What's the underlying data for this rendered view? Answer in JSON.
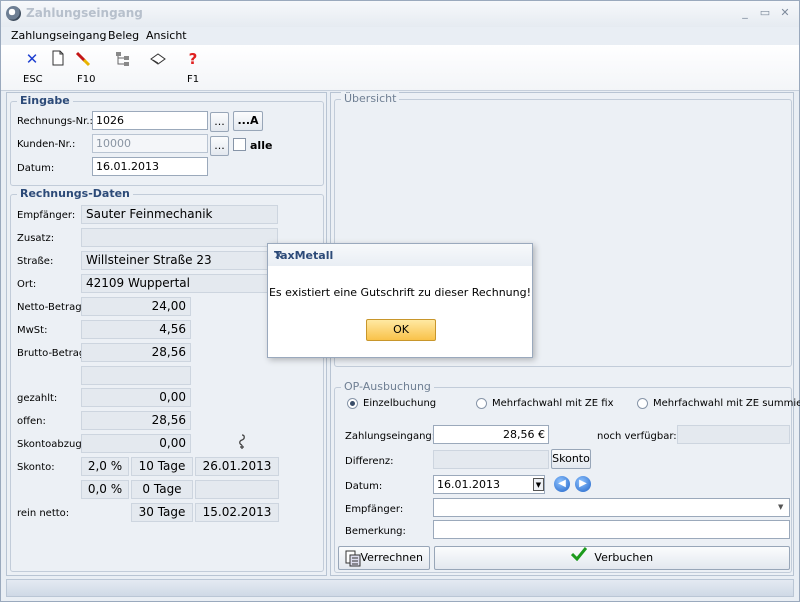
{
  "window": {
    "title": "Zahlungseingang",
    "minimize": "_",
    "maximize": "▭",
    "close": "✕"
  },
  "menu": [
    "Zahlungseingang",
    "Beleg",
    "Ansicht"
  ],
  "toolbar": {
    "esc_label": "ESC",
    "f10_label": "F10",
    "f1_label": "F1",
    "help_glyph": "?"
  },
  "eingabe": {
    "title": "Eingabe",
    "rechnungsnr_label": "Rechnungs-Nr.:",
    "rechnungsnr_value": "1026",
    "kundennr_label": "Kunden-Nr.:",
    "kundennr_value": "10000",
    "datum_label": "Datum:",
    "datum_value": "16.01.2013",
    "dots": "...",
    "a_button": "...A",
    "alle_label": "alle"
  },
  "rechnung": {
    "title": "Rechnungs-Daten",
    "empfaenger_label": "Empfänger:",
    "empfaenger_value": "Sauter Feinmechanik",
    "zusatz_label": "Zusatz:",
    "zusatz_value": "",
    "strasse_label": "Straße:",
    "strasse_value": "Willsteiner Straße 23",
    "ort_label": "Ort:",
    "ort_value": "42109 Wuppertal",
    "netto_label": "Netto-Betrag:",
    "netto_value": "24,00",
    "mwst_label": "MwSt:",
    "mwst_value": "4,56",
    "brutto_label": "Brutto-Betrag:",
    "brutto_value": "28,56",
    "gezahlt_label": "gezahlt:",
    "gezahlt_value": "0,00",
    "offen_label": "offen:",
    "offen_value": "28,56",
    "skontoabzug_label": "Skontoabzug:",
    "skontoabzug_value": "0,00",
    "skonto_label": "Skonto:",
    "skonto1_pct": "2,0 %",
    "skonto1_days": "10 Tage",
    "skonto1_date": "26.01.2013",
    "skonto2_pct": "0,0 %",
    "skonto2_days": "0 Tage",
    "reinnetto_label": "rein netto:",
    "reinnetto_days": "30 Tage",
    "reinnetto_date": "15.02.2013"
  },
  "uebersicht": {
    "title": "Übersicht"
  },
  "op": {
    "title": "OP-Ausbuchung",
    "radio1": "Einzelbuchung",
    "radio2": "Mehrfachwahl mit ZE fix",
    "radio3": "Mehrfachwahl mit ZE summiert",
    "zahlungseingang_label": "Zahlungseingang:",
    "zahlungseingang_value": "28,56 €",
    "noch_label": "noch verfügbar:",
    "differenz_label": "Differenz:",
    "skonto_button": "Skonto",
    "datum_label": "Datum:",
    "datum_value": "16.01.2013",
    "empfaenger_label": "Empfänger:",
    "bemerkung_label": "Bemerkung:",
    "verrechnen_button": "Verrechnen",
    "verbuchen_button": "Verbuchen"
  },
  "dialog": {
    "title": "TaxMetall",
    "close": "✕",
    "message": "Es existiert eine Gutschrift zu dieser Rechnung!",
    "ok": "OK"
  }
}
